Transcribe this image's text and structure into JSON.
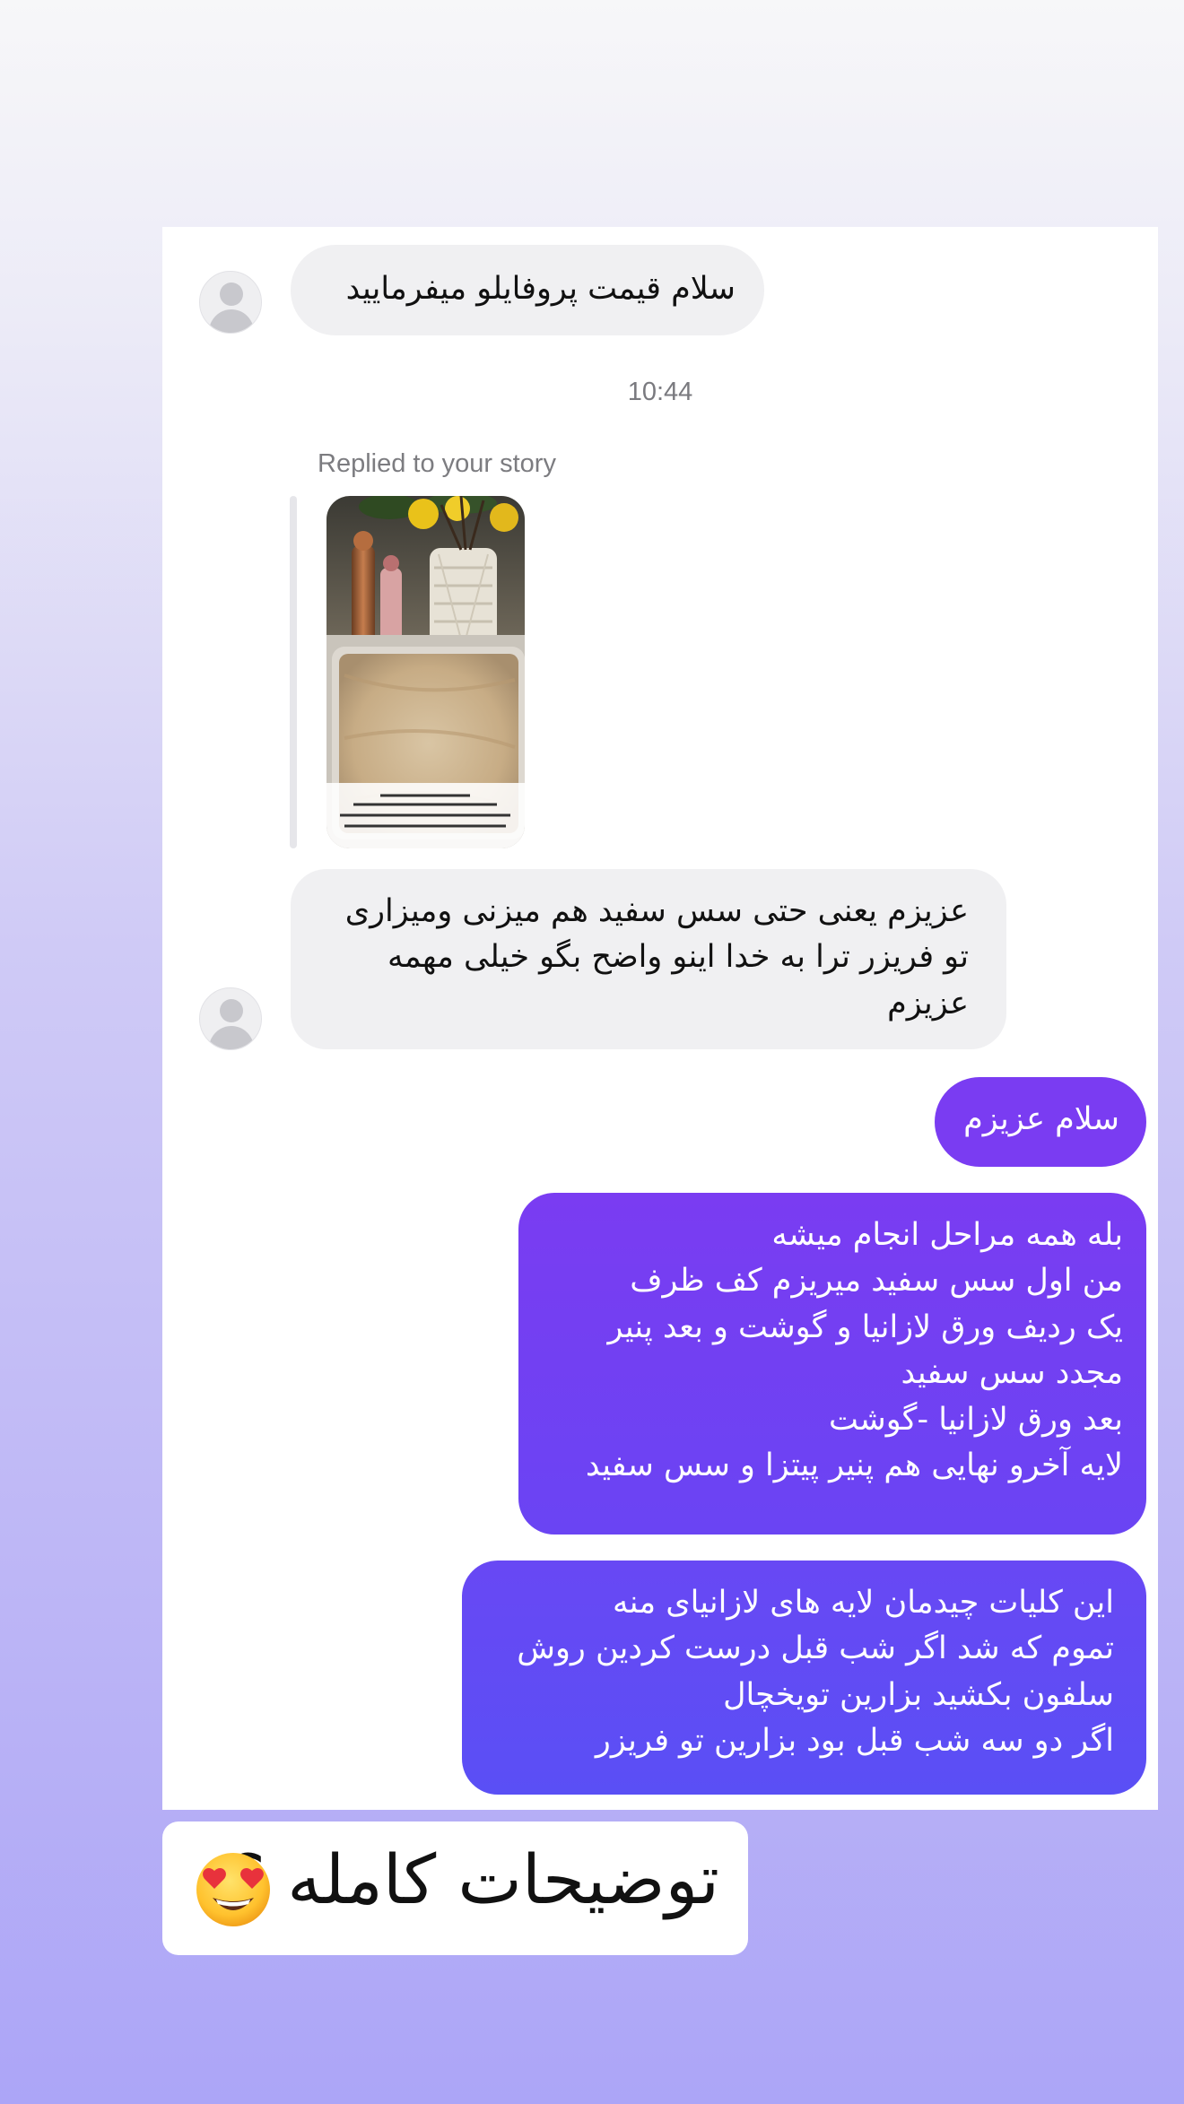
{
  "thread": {
    "messages": [
      {
        "id": "m1",
        "sender": "them",
        "text": "سلام قیمت پروفایلو میفرمایید"
      },
      {
        "id": "m2",
        "sender": "them",
        "text": "عزیزم یعنی حتی سس سفید هم میزنی ومیزاری\nتو فریزر ترا به خدا اینو واضح بگو خیلی مهمه\nعزیزم"
      },
      {
        "id": "m3",
        "sender": "me",
        "text": "سلام عزیزم"
      },
      {
        "id": "m4",
        "sender": "me",
        "text": "بله همه مراحل انجام میشه\nمن اول سس سفید میریزم کف ظرف\nیک ردیف ورق لازانیا و گوشت و بعد پنیر\nمجدد سس سفید\nبعد ورق لازانیا -گوشت\nلایه آخرو نهایی هم پنیر پیتزا و سس سفید"
      },
      {
        "id": "m5",
        "sender": "me",
        "text": "این کلیات چیدمان لایه های لازانیای منه\nتموم که شد اگر شب قبل درست کردین روش\nسلفون بکشید بزارین تویخچال\nاگر دو سه شب قبل بود بزارین تو فریزر"
      }
    ],
    "timestamp": "10:44",
    "reply": {
      "caption": "Replied to your story",
      "thumbnail_overlay_text": "دیشب همه کارهای لازانیا رو کردم\nروی تو یخچال تا امروز گذاشتن تو فریزر\nمیخوام بدونین دونی بود مهمونی شلوغ هستید لازانیا رو حتی از دو سه روز\nقبل از هم درست کنید سفارش میشه و کلی کارتون سبکتر از میشه"
    }
  },
  "caption_sticker": {
    "text": "توضیحات کامله ؟",
    "emoji": "heart-eyes-emoji"
  },
  "colors": {
    "incoming_bubble": "#f0f0f2",
    "outgoing_gradient_top": "#7a3cf2",
    "outgoing_gradient_bottom": "#5a4ff5",
    "background_top": "#f7f7f9",
    "background_bottom": "#aca5f7"
  }
}
